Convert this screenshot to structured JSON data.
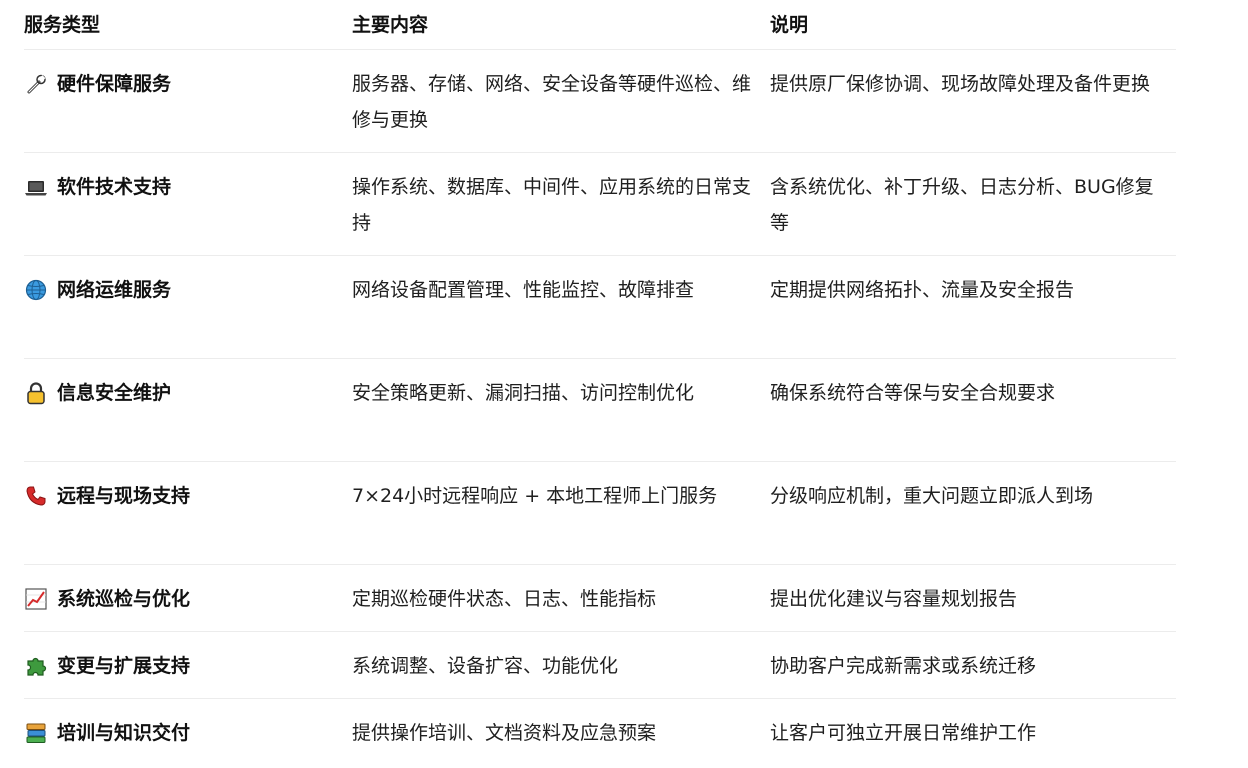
{
  "headers": {
    "type": "服务类型",
    "content": "主要内容",
    "desc": "说明"
  },
  "rows": [
    {
      "icon": "wrench-icon",
      "type": "硬件保障服务",
      "content": "服务器、存储、网络、安全设备等硬件巡检、维修与更换",
      "desc": "提供原厂保修协调、现场故障处理及备件更换"
    },
    {
      "icon": "laptop-icon",
      "type": "软件技术支持",
      "content": "操作系统、数据库、中间件、应用系统的日常支持",
      "desc": "含系统优化、补丁升级、日志分析、BUG修复等"
    },
    {
      "icon": "globe-icon",
      "type": "网络运维服务",
      "content": "网络设备配置管理、性能监控、故障排查",
      "desc": "定期提供网络拓扑、流量及安全报告"
    },
    {
      "icon": "lock-icon",
      "type": "信息安全维护",
      "content": "安全策略更新、漏洞扫描、访问控制优化",
      "desc": "确保系统符合等保与安全合规要求"
    },
    {
      "icon": "telephone-icon",
      "type": "远程与现场支持",
      "content": "7×24小时远程响应 + 本地工程师上门服务",
      "desc": "分级响应机制，重大问题立即派人到场"
    },
    {
      "icon": "chart-increasing-icon",
      "type": "系统巡检与优化",
      "content": "定期巡检硬件状态、日志、性能指标",
      "desc": "提出优化建议与容量规划报告"
    },
    {
      "icon": "puzzle-icon",
      "type": "变更与扩展支持",
      "content": "系统调整、设备扩容、功能优化",
      "desc": "协助客户完成新需求或系统迁移"
    },
    {
      "icon": "books-icon",
      "type": "培训与知识交付",
      "content": "提供操作培训、文档资料及应急预案",
      "desc": "让客户可独立开展日常维护工作"
    }
  ]
}
